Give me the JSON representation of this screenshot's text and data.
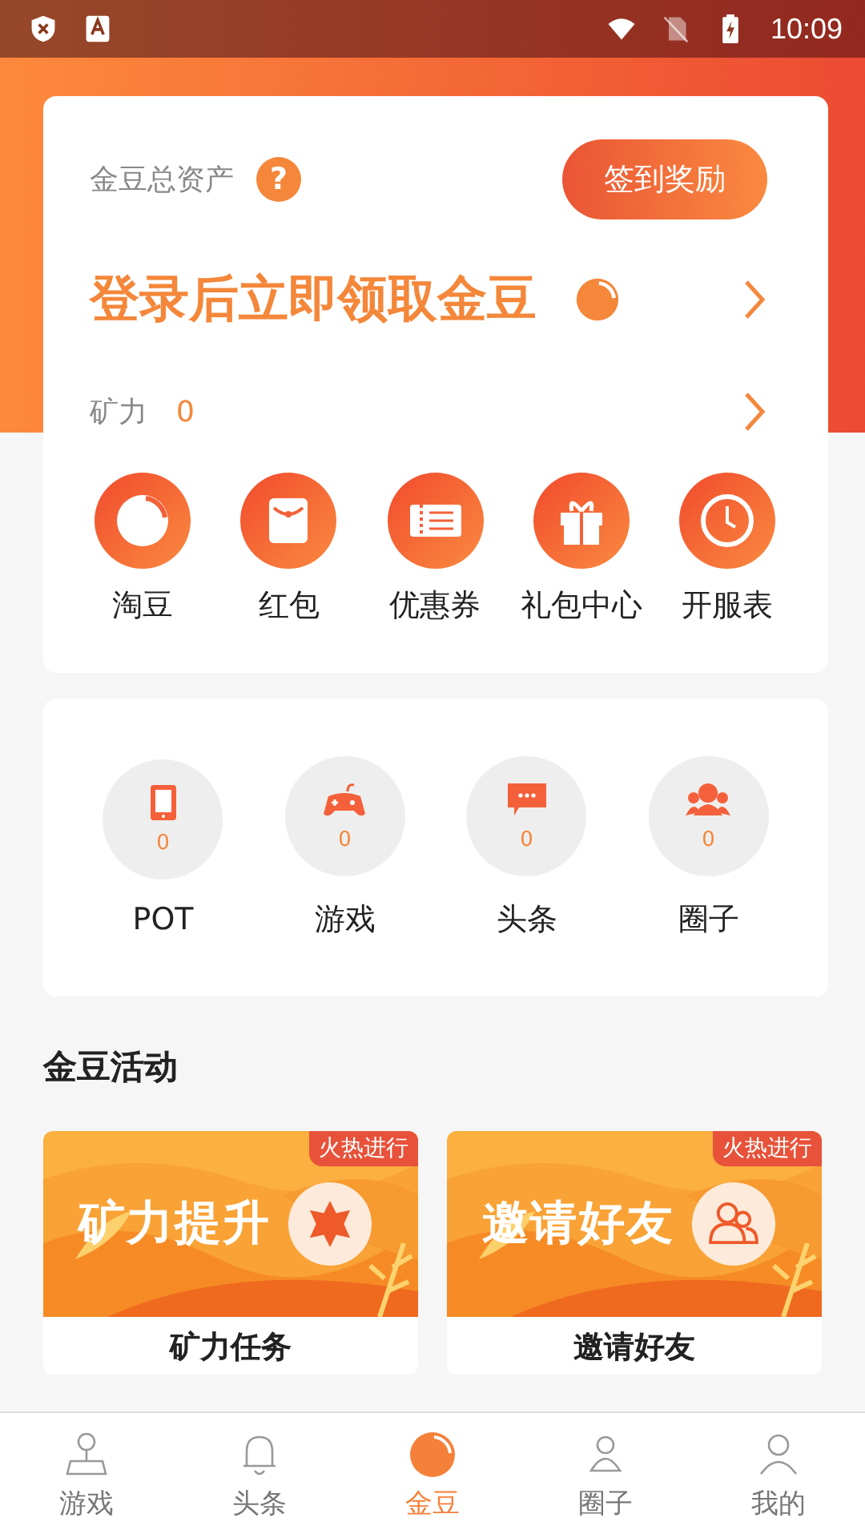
{
  "status_bar": {
    "time": "10:09"
  },
  "assets": {
    "label": "金豆总资产",
    "help": "?",
    "signin_button": "签到奖励",
    "login_prompt": "登录后立即领取金豆",
    "power_label": "矿力",
    "power_value": "0"
  },
  "shortcuts": [
    {
      "label": "淘豆",
      "kind": "bean"
    },
    {
      "label": "红包",
      "kind": "envelope"
    },
    {
      "label": "优惠券",
      "kind": "ticket"
    },
    {
      "label": "礼包中心",
      "kind": "gift"
    },
    {
      "label": "开服表",
      "kind": "clock"
    }
  ],
  "stats": [
    {
      "label": "POT",
      "value": "0",
      "kind": "tablet"
    },
    {
      "label": "游戏",
      "value": "0",
      "kind": "gamepad"
    },
    {
      "label": "头条",
      "value": "0",
      "kind": "chat"
    },
    {
      "label": "圈子",
      "value": "0",
      "kind": "group"
    }
  ],
  "activities_title": "金豆活动",
  "activities": [
    {
      "banner": "矿力提升",
      "badge": "火热进行",
      "title": "矿力任务",
      "kind": "star"
    },
    {
      "banner": "邀请好友",
      "badge": "火热进行",
      "title": "邀请好友",
      "kind": "friends"
    }
  ],
  "nav": [
    {
      "label": "游戏",
      "kind": "joystick",
      "selected": false
    },
    {
      "label": "头条",
      "kind": "bell",
      "selected": false
    },
    {
      "label": "金豆",
      "kind": "bean",
      "selected": true
    },
    {
      "label": "圈子",
      "kind": "group",
      "selected": false
    },
    {
      "label": "我的",
      "kind": "person",
      "selected": false
    }
  ]
}
